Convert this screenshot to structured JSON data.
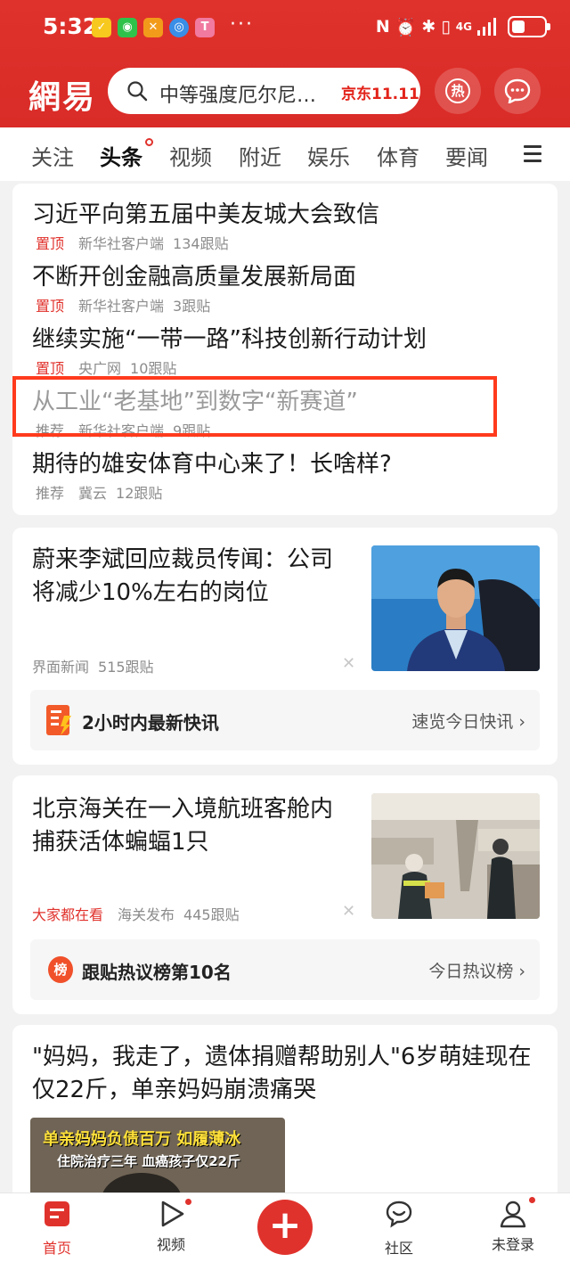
{
  "status_bar": {
    "time": "5:32",
    "more": "···",
    "network": "4G",
    "app_icons": [
      "yellow-app-icon",
      "wechat-icon",
      "orange-app-icon",
      "browser-icon",
      "pink-app-icon"
    ]
  },
  "header": {
    "logo": "網易",
    "search_placeholder": "中等强度厄尔尼…",
    "search_ad": "京东11.11",
    "hot_label": "热"
  },
  "tabs": [
    {
      "label": "关注"
    },
    {
      "label": "头条"
    },
    {
      "label": "视频"
    },
    {
      "label": "附近"
    },
    {
      "label": "娱乐"
    },
    {
      "label": "体育"
    },
    {
      "label": "要闻"
    }
  ],
  "top_news": [
    {
      "title": "习近平向第五届中美友城大会致信",
      "tag": "置顶",
      "source": "新华社客户端",
      "comments": "134跟贴"
    },
    {
      "title": "不断开创金融高质量发展新局面",
      "tag": "置顶",
      "source": "新华社客户端",
      "comments": "3跟贴"
    },
    {
      "title": "继续实施“一带一路”科技创新行动计划",
      "tag": "置顶",
      "source": "央广网",
      "comments": "10跟贴"
    },
    {
      "title": "从工业“老基地”到数字“新赛道”",
      "tag": "推荐",
      "source": "新华社客户端",
      "comments": "9跟贴"
    },
    {
      "title": "期待的雄安体育中心来了！长啥样?",
      "tag": "推荐",
      "source": "冀云",
      "comments": "12跟贴"
    }
  ],
  "articles": [
    {
      "title": "蔚来李斌回应裁员传闻：公司将减少10%左右的岗位",
      "source": "界面新闻",
      "comments": "515跟贴",
      "promo_title": "2小时内最新快讯",
      "promo_link": "速览今日快讯"
    },
    {
      "title": "北京海关在一入境航班客舱内捕获活体蝙蝠1只",
      "hot_tag": "大家都在看",
      "source": "海关发布",
      "comments": "445跟贴",
      "promo_badge": "榜",
      "promo_title": "跟贴热议榜第10名",
      "promo_link": "今日热议榜"
    },
    {
      "title": "\"妈妈，我走了，遗体捐赠帮助别人\"6岁萌娃现在仅22斤，单亲妈妈崩溃痛哭",
      "thumb_caption_1": "单亲妈妈负债百万 如履薄冰",
      "thumb_caption_2": "住院治疗三年 血癌孩子仅22斤"
    }
  ],
  "bottom_nav": [
    {
      "label": "首页"
    },
    {
      "label": "视频"
    },
    {
      "label": "社区"
    },
    {
      "label": "未登录"
    }
  ],
  "colors": {
    "brand_red": "#e0322c",
    "highlight_box": "#ff3b1d"
  }
}
